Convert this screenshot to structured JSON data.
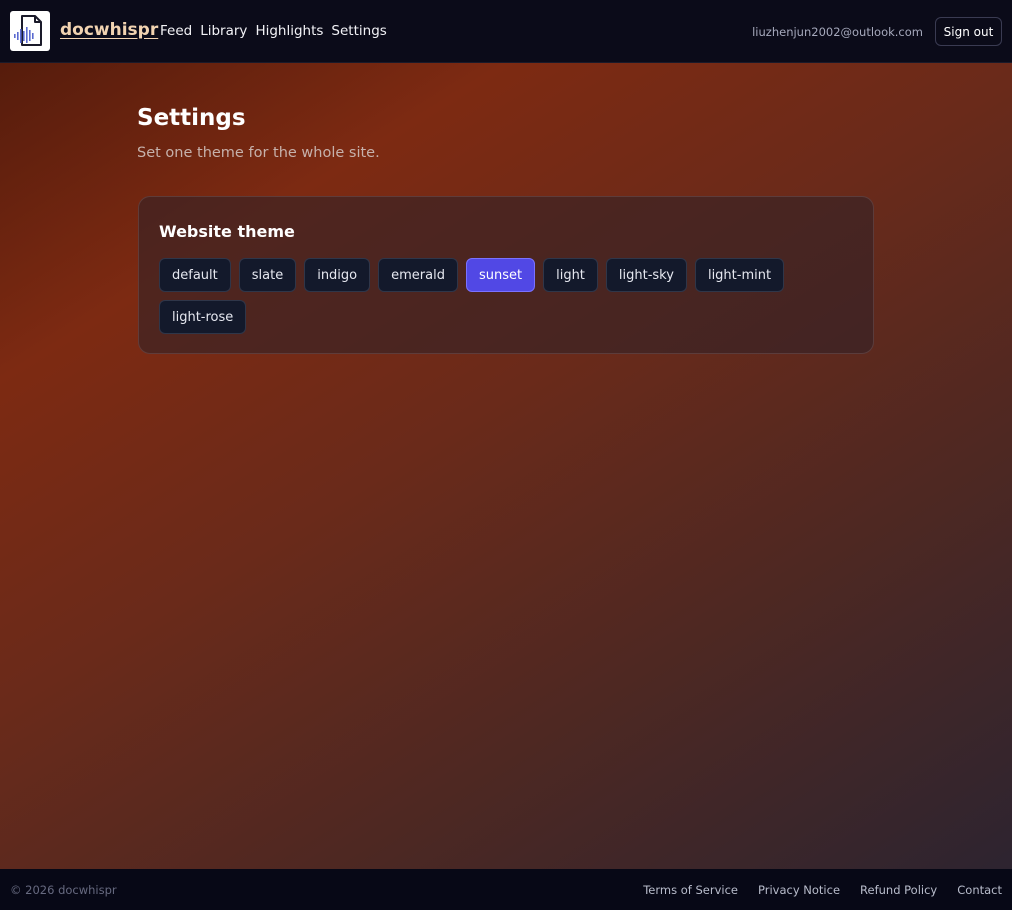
{
  "header": {
    "brand": "docwhispr",
    "logo_icon": "document-audio-icon",
    "nav": [
      "Feed",
      "Library",
      "Highlights",
      "Settings"
    ],
    "user_email": "liuzhenjun2002@outlook.com",
    "sign_out_label": "Sign out"
  },
  "page": {
    "title": "Settings",
    "subtitle": "Set one theme for the whole site."
  },
  "theme_card": {
    "title": "Website theme",
    "selected": "sunset",
    "options": [
      "default",
      "slate",
      "indigo",
      "emerald",
      "sunset",
      "light",
      "light-sky",
      "light-mint",
      "light-rose"
    ]
  },
  "footer": {
    "copyright": "© 2026 docwhispr",
    "links": [
      "Terms of Service",
      "Privacy Notice",
      "Refund Policy",
      "Contact"
    ]
  },
  "colors": {
    "accent": "#5148e5",
    "brand": "#f1d3b1",
    "header_bg": "#0b0b19"
  }
}
